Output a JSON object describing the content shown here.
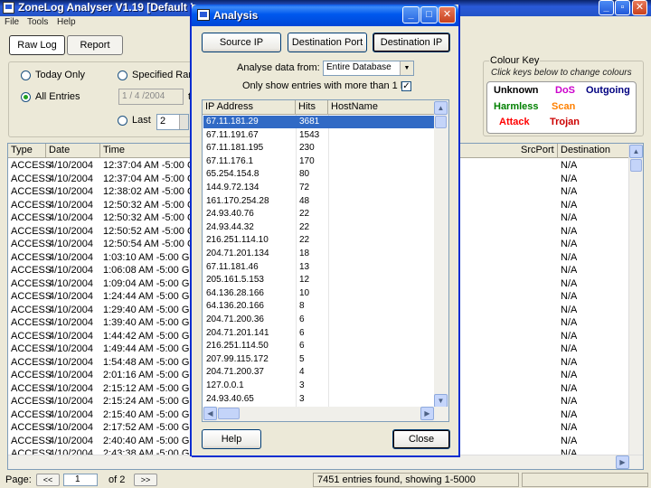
{
  "main": {
    "title": "ZoneLog Analyser V1.19  [Default L",
    "menu": [
      "File",
      "Tools",
      "Help"
    ],
    "tabs": [
      "Raw Log",
      "Report"
    ],
    "filter": {
      "today_only": "Today Only",
      "all_entries": "All Entries",
      "specified_range": "Specified Rang",
      "date": "1 / 4 /2004",
      "last": "Last",
      "last_value": "2",
      "truncated_t": "t"
    },
    "colour_key": {
      "title": "Colour Key",
      "hint": "Click keys below to change colours",
      "keys": [
        {
          "label": "Unknown",
          "color": "#000000"
        },
        {
          "label": "DoS",
          "color": "#cc00cc"
        },
        {
          "label": "Outgoing",
          "color": "#000080"
        },
        {
          "label": "Harmless",
          "color": "#008000"
        },
        {
          "label": "Scan",
          "color": "#ff8000"
        },
        {
          "label": "Attack",
          "color": "#ff0000"
        },
        {
          "label": "Trojan",
          "color": "#cc0000"
        }
      ]
    },
    "log": {
      "headers": [
        "Type",
        "Date",
        "Time",
        "SrcPort",
        "Destination"
      ],
      "rows": [
        {
          "type": "ACCESS",
          "date": "4/10/2004",
          "time": "12:37:04 AM -5:00 GI",
          "dest": "N/A"
        },
        {
          "type": "ACCESS",
          "date": "4/10/2004",
          "time": "12:37:04 AM -5:00 GI",
          "dest": "N/A"
        },
        {
          "type": "ACCESS",
          "date": "4/10/2004",
          "time": "12:38:02 AM -5:00 GI",
          "dest": "N/A"
        },
        {
          "type": "ACCESS",
          "date": "4/10/2004",
          "time": "12:50:32 AM -5:00 GI",
          "dest": "N/A"
        },
        {
          "type": "ACCESS",
          "date": "4/10/2004",
          "time": "12:50:32 AM -5:00 GI",
          "dest": "N/A"
        },
        {
          "type": "ACCESS",
          "date": "4/10/2004",
          "time": "12:50:52 AM -5:00 GI",
          "dest": "N/A"
        },
        {
          "type": "ACCESS",
          "date": "4/10/2004",
          "time": "12:50:54 AM -5:00 GI",
          "dest": "N/A"
        },
        {
          "type": "ACCESS",
          "date": "4/10/2004",
          "time": "1:03:10 AM -5:00 GM",
          "dest": "N/A"
        },
        {
          "type": "ACCESS",
          "date": "4/10/2004",
          "time": "1:06:08 AM -5:00 GM",
          "dest": "N/A"
        },
        {
          "type": "ACCESS",
          "date": "4/10/2004",
          "time": "1:09:04 AM -5:00 GM",
          "dest": "N/A"
        },
        {
          "type": "ACCESS",
          "date": "4/10/2004",
          "time": "1:24:44 AM -5:00 GM",
          "dest": "N/A"
        },
        {
          "type": "ACCESS",
          "date": "4/10/2004",
          "time": "1:29:40 AM -5:00 GM",
          "dest": "N/A"
        },
        {
          "type": "ACCESS",
          "date": "4/10/2004",
          "time": "1:39:40 AM -5:00 GM",
          "dest": "N/A"
        },
        {
          "type": "ACCESS",
          "date": "4/10/2004",
          "time": "1:44:42 AM -5:00 GM",
          "dest": "N/A"
        },
        {
          "type": "ACCESS",
          "date": "4/10/2004",
          "time": "1:49:44 AM -5:00 GM",
          "dest": "N/A"
        },
        {
          "type": "ACCESS",
          "date": "4/10/2004",
          "time": "1:54:48 AM -5:00 GM",
          "dest": "N/A"
        },
        {
          "type": "ACCESS",
          "date": "4/10/2004",
          "time": "2:01:16 AM -5:00 GM",
          "dest": "N/A"
        },
        {
          "type": "ACCESS",
          "date": "4/10/2004",
          "time": "2:15:12 AM -5:00 GM",
          "dest": "N/A"
        },
        {
          "type": "ACCESS",
          "date": "4/10/2004",
          "time": "2:15:24 AM -5:00 GM",
          "dest": "N/A"
        },
        {
          "type": "ACCESS",
          "date": "4/10/2004",
          "time": "2:15:40 AM -5:00 GM",
          "dest": "N/A"
        },
        {
          "type": "ACCESS",
          "date": "4/10/2004",
          "time": "2:17:52 AM -5:00 GM",
          "dest": "N/A"
        },
        {
          "type": "ACCESS",
          "date": "4/10/2004",
          "time": "2:40:40 AM -5:00 GM",
          "dest": "N/A"
        },
        {
          "type": "ACCESS",
          "date": "4/10/2004",
          "time": "2:43:38 AM -5:00 GM",
          "dest": "N/A"
        }
      ]
    },
    "status": {
      "page_label": "Page:",
      "prev": "<<",
      "page": "1",
      "of": "of 2",
      "next": ">>",
      "info": "7451 entries found, showing 1-5000"
    }
  },
  "analysis": {
    "title": "Analysis",
    "buttons": {
      "source_ip": "Source IP",
      "dest_port": "Destination Port",
      "dest_ip": "Destination IP",
      "help": "Help",
      "close": "Close"
    },
    "analyse_label": "Analyse data from:",
    "analyse_value": "Entire Database",
    "only_label": "Only show entries with more than 1 hit",
    "only_checked": true,
    "headers": [
      "IP Address",
      "Hits",
      "HostName"
    ],
    "rows": [
      {
        "ip": "67.11.181.29",
        "hits": "3681"
      },
      {
        "ip": "67.11.191.67",
        "hits": "1543"
      },
      {
        "ip": "67.11.181.195",
        "hits": "230"
      },
      {
        "ip": "67.11.176.1",
        "hits": "170"
      },
      {
        "ip": "65.254.154.8",
        "hits": "80"
      },
      {
        "ip": "144.9.72.134",
        "hits": "72"
      },
      {
        "ip": "161.170.254.28",
        "hits": "48"
      },
      {
        "ip": "24.93.40.76",
        "hits": "22"
      },
      {
        "ip": "24.93.44.32",
        "hits": "22"
      },
      {
        "ip": "216.251.114.10",
        "hits": "22"
      },
      {
        "ip": "204.71.201.134",
        "hits": "18"
      },
      {
        "ip": "67.11.181.46",
        "hits": "13"
      },
      {
        "ip": "205.161.5.153",
        "hits": "12"
      },
      {
        "ip": "64.136.28.166",
        "hits": "10"
      },
      {
        "ip": "64.136.20.166",
        "hits": "8"
      },
      {
        "ip": "204.71.200.36",
        "hits": "6"
      },
      {
        "ip": "204.71.201.141",
        "hits": "6"
      },
      {
        "ip": "216.251.114.50",
        "hits": "6"
      },
      {
        "ip": "207.99.115.172",
        "hits": "5"
      },
      {
        "ip": "204.71.200.37",
        "hits": "4"
      },
      {
        "ip": "127.0.0.1",
        "hits": "3"
      },
      {
        "ip": "24.93.40.65",
        "hits": "3"
      }
    ]
  }
}
